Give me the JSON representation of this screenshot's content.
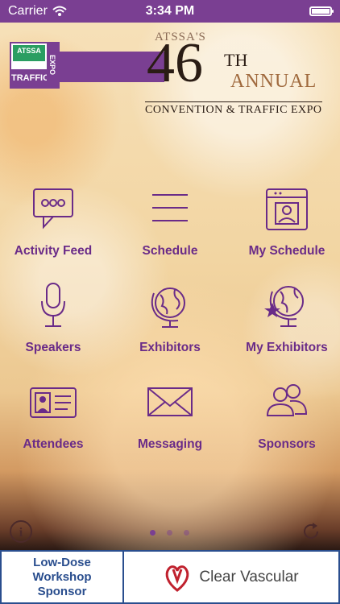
{
  "statusbar": {
    "carrier": "Carrier",
    "time": "3:34 PM"
  },
  "header": {
    "logo_top": "ATSSA",
    "logo_traffic": "TRAFFIC",
    "logo_expo": "EXPO",
    "atssas": "ATSSA'S",
    "number": "46",
    "suffix": "TH",
    "annual": "ANNUAL",
    "subtitle": "CONVENTION & TRAFFIC EXPO"
  },
  "menu": [
    {
      "label": "Activity Feed",
      "icon": "speech-bubble-icon"
    },
    {
      "label": "Schedule",
      "icon": "list-icon"
    },
    {
      "label": "My Schedule",
      "icon": "calendar-person-icon"
    },
    {
      "label": "Speakers",
      "icon": "microphone-icon"
    },
    {
      "label": "Exhibitors",
      "icon": "globe-icon"
    },
    {
      "label": "My Exhibitors",
      "icon": "globe-star-icon"
    },
    {
      "label": "Attendees",
      "icon": "id-card-icon"
    },
    {
      "label": "Messaging",
      "icon": "envelope-icon"
    },
    {
      "label": "Sponsors",
      "icon": "people-icon"
    }
  ],
  "sponsor": {
    "left_line1": "Low-Dose",
    "left_line2": "Workshop",
    "left_line3": "Sponsor",
    "brand": "Clear Vascular"
  },
  "colors": {
    "accent": "#7a3f92",
    "sponsor_border": "#2a4e8e"
  }
}
